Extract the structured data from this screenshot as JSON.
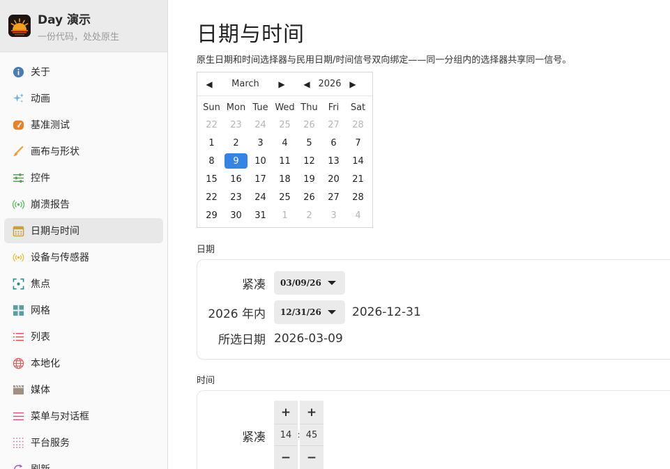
{
  "app": {
    "name": "Day 演示",
    "tagline": "一份代码，处处原生"
  },
  "nav": {
    "items": [
      {
        "label": "关于",
        "icon": "info-icon",
        "color": "#4a7bb7"
      },
      {
        "label": "动画",
        "icon": "sparkle-icon",
        "color": "#6ab0e0"
      },
      {
        "label": "基准测试",
        "icon": "gauge-icon",
        "color": "#e8822a"
      },
      {
        "label": "画布与形状",
        "icon": "brush-icon",
        "color": "#f0a040"
      },
      {
        "label": "控件",
        "icon": "sliders-icon",
        "color": "#5aa05a"
      },
      {
        "label": "崩溃报告",
        "icon": "broadcast-icon",
        "color": "#5ab85a"
      },
      {
        "label": "日期与时间",
        "icon": "calendar-icon",
        "color": "#c8a040"
      },
      {
        "label": "设备与传感器",
        "icon": "sensor-icon",
        "color": "#e8c040"
      },
      {
        "label": "焦点",
        "icon": "focus-icon",
        "color": "#2a8a8a"
      },
      {
        "label": "网格",
        "icon": "grid-icon",
        "color": "#5aa0a0"
      },
      {
        "label": "列表",
        "icon": "list-icon",
        "color": "#e05050"
      },
      {
        "label": "本地化",
        "icon": "globe-icon",
        "color": "#e06060"
      },
      {
        "label": "媒体",
        "icon": "clapper-icon",
        "color": "#a09080"
      },
      {
        "label": "菜单与对话框",
        "icon": "menu-icon",
        "color": "#d05080"
      },
      {
        "label": "平台服务",
        "icon": "dots-grid-icon",
        "color": "#d080a0"
      },
      {
        "label": "刷新",
        "icon": "refresh-icon",
        "color": "#a060c0"
      }
    ],
    "active_index": 6
  },
  "page": {
    "title": "日期与时间",
    "description": "原生日期和时间选择器与民用日期/时间信号双向绑定——同一分组内的选择器共享同一信号。"
  },
  "calendar": {
    "month": "March",
    "year": "2026",
    "weekdays": [
      "Sun",
      "Mon",
      "Tue",
      "Wed",
      "Thu",
      "Fri",
      "Sat"
    ],
    "weeks": [
      [
        [
          "22",
          1
        ],
        [
          "23",
          1
        ],
        [
          "24",
          1
        ],
        [
          "25",
          1
        ],
        [
          "26",
          1
        ],
        [
          "27",
          1
        ],
        [
          "28",
          1
        ]
      ],
      [
        [
          "1",
          0
        ],
        [
          "2",
          0
        ],
        [
          "3",
          0
        ],
        [
          "4",
          0
        ],
        [
          "5",
          0
        ],
        [
          "6",
          0
        ],
        [
          "7",
          0
        ]
      ],
      [
        [
          "8",
          0
        ],
        [
          "9",
          2
        ],
        [
          "10",
          0
        ],
        [
          "11",
          0
        ],
        [
          "12",
          0
        ],
        [
          "13",
          0
        ],
        [
          "14",
          0
        ]
      ],
      [
        [
          "15",
          0
        ],
        [
          "16",
          0
        ],
        [
          "17",
          0
        ],
        [
          "18",
          0
        ],
        [
          "19",
          0
        ],
        [
          "20",
          0
        ],
        [
          "21",
          0
        ]
      ],
      [
        [
          "22",
          0
        ],
        [
          "23",
          0
        ],
        [
          "24",
          0
        ],
        [
          "25",
          0
        ],
        [
          "26",
          0
        ],
        [
          "27",
          0
        ],
        [
          "28",
          0
        ]
      ],
      [
        [
          "29",
          0
        ],
        [
          "30",
          0
        ],
        [
          "31",
          0
        ],
        [
          "1",
          1
        ],
        [
          "2",
          1
        ],
        [
          "3",
          1
        ],
        [
          "4",
          1
        ]
      ]
    ],
    "selected_color": "#3584e4"
  },
  "date_section": {
    "label": "日期",
    "compact_label": "紧凑",
    "compact_value": "03/09/26",
    "within_year_label": "2026 年内",
    "within_year_value": "12/31/26",
    "within_year_display": "2026-12-31",
    "selected_label": "所选日期",
    "selected_value": "2026-03-09"
  },
  "time_section": {
    "label": "时间",
    "compact_label": "紧凑",
    "hour": "14",
    "minute": "45",
    "separator": ":",
    "plus": "+",
    "minus": "−"
  }
}
